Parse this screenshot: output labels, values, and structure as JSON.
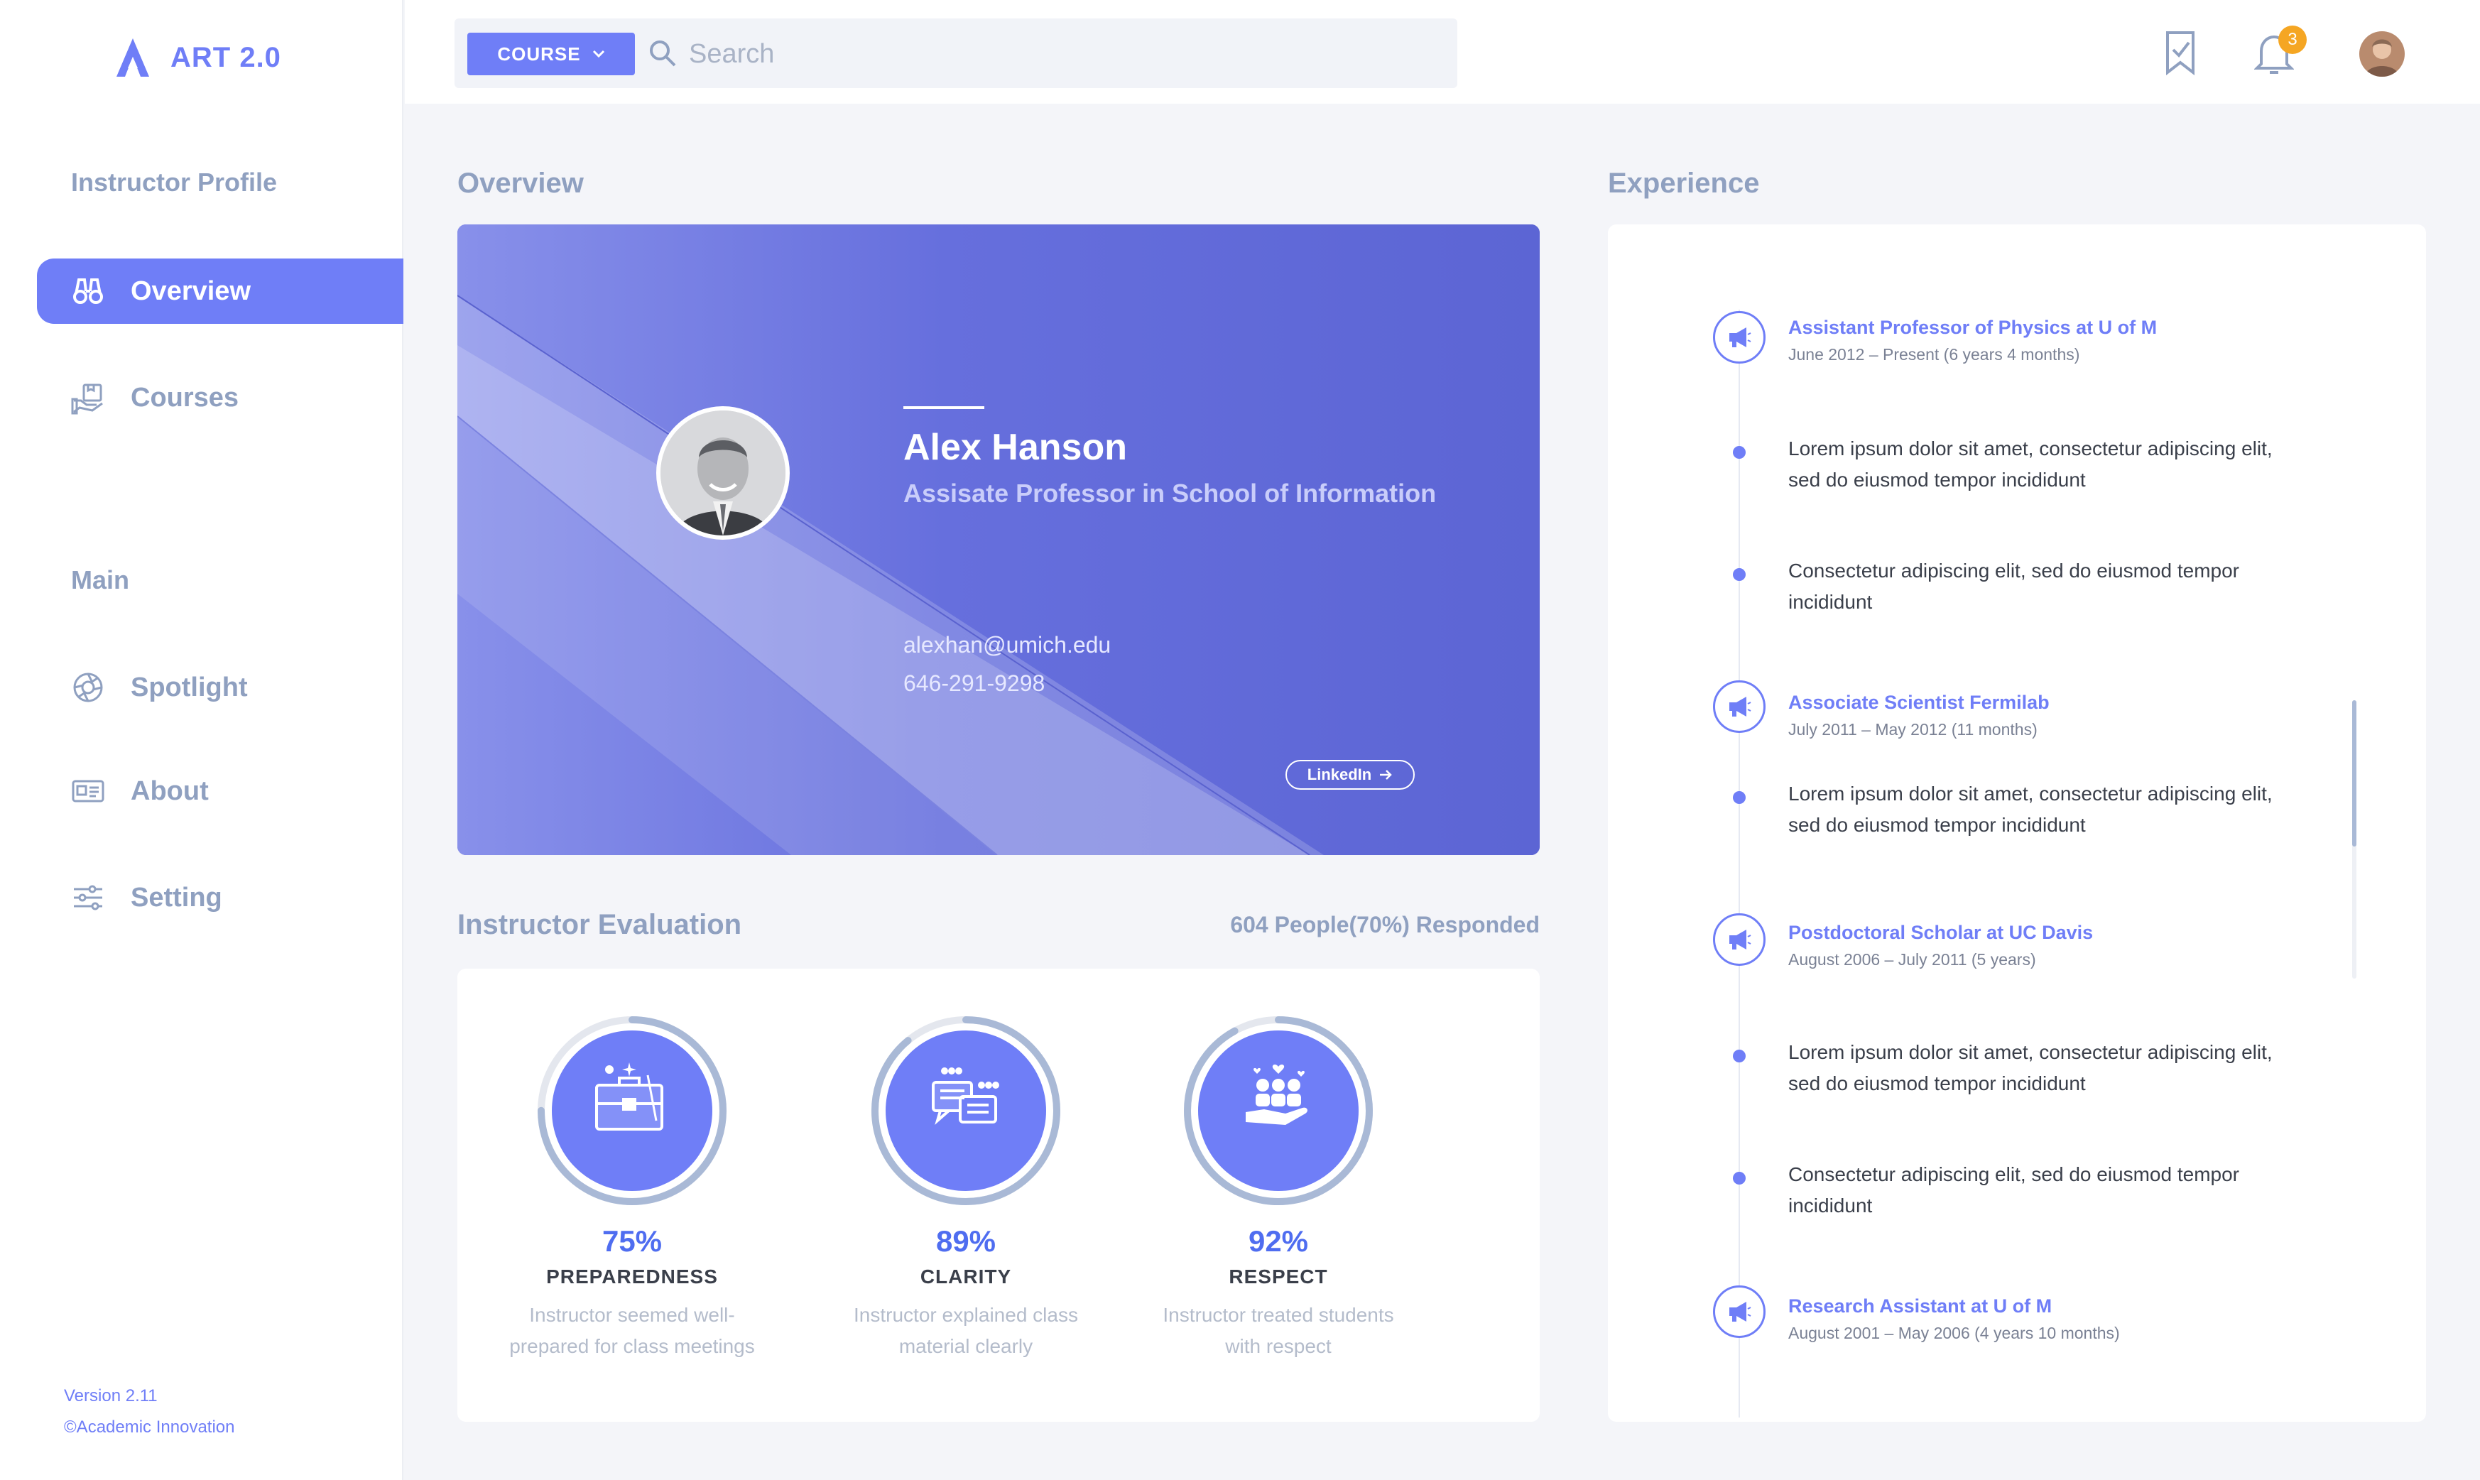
{
  "app": {
    "name": "ART 2.0",
    "version": "Version 2.11",
    "copyright": "©Academic Innovation"
  },
  "sidebar": {
    "heading_profile": "Instructor Profile",
    "heading_main": "Main",
    "items": [
      {
        "label": "Overview",
        "icon": "binoculars-icon",
        "active": true
      },
      {
        "label": "Courses",
        "icon": "courses-icon",
        "active": false
      },
      {
        "label": "Spotlight",
        "icon": "aperture-icon",
        "active": false
      },
      {
        "label": "About",
        "icon": "id-card-icon",
        "active": false
      },
      {
        "label": "Setting",
        "icon": "sliders-icon",
        "active": false
      }
    ]
  },
  "topbar": {
    "course_button": "COURSE",
    "search_placeholder": "Search",
    "notification_count": "3"
  },
  "overview": {
    "section_title": "Overview",
    "name": "Alex Hanson",
    "title": "Assisate Professor in School of Information",
    "email": "alexhan@umich.edu",
    "phone": "646-291-9298",
    "linkedin_label": "LinkedIn"
  },
  "evaluation": {
    "section_title": "Instructor Evaluation",
    "responded": "604 People(70%) Responded",
    "items": [
      {
        "percent": "75%",
        "value": 0.75,
        "name": "PREPAREDNESS",
        "desc_line1": "Instructor seemed well-",
        "desc_line2": "prepared for class meetings",
        "icon": "briefcase-icon"
      },
      {
        "percent": "89%",
        "value": 0.89,
        "name": "CLARITY",
        "desc_line1": "Instructor explained class",
        "desc_line2": "material clearly",
        "icon": "chat-bubbles-icon"
      },
      {
        "percent": "92%",
        "value": 0.92,
        "name": "RESPECT",
        "desc_line1": "Instructor treated students",
        "desc_line2": "with respect",
        "icon": "people-hand-icon"
      }
    ]
  },
  "experience": {
    "section_title": "Experience",
    "jobs": [
      {
        "title": "Assistant Professor of Physics at U of M",
        "dates": "June 2012 – Present (6 years 4 months)"
      },
      {
        "title": "Associate Scientist Fermilab",
        "dates": "July 2011 – May 2012 (11 months)"
      },
      {
        "title": "Postdoctoral Scholar at UC Davis",
        "dates": "August 2006 – July 2011 (5 years)"
      },
      {
        "title": "Research Assistant at U of M",
        "dates": "August 2001 – May 2006 (4 years 10 months)"
      }
    ],
    "bullets": [
      {
        "line1": "Lorem ipsum dolor sit amet, consectetur adipiscing elit,",
        "line2": "sed do eiusmod tempor incididunt"
      },
      {
        "line1": "Consectetur adipiscing elit, sed do eiusmod tempor",
        "line2": "incididunt"
      },
      {
        "line1": "Lorem ipsum dolor sit amet, consectetur adipiscing elit,",
        "line2": "sed do eiusmod tempor incididunt"
      },
      {
        "line1": "Lorem ipsum dolor sit amet, consectetur adipiscing elit,",
        "line2": "sed do eiusmod tempor incididunt"
      },
      {
        "line1": "Consectetur adipiscing elit, sed do eiusmod tempor",
        "line2": "incididunt"
      }
    ]
  },
  "colors": {
    "accent": "#6f7ef7",
    "card": "#6169d8",
    "muted": "#8fa0c0",
    "badge": "#f5a623",
    "ring": "#a9b9d6"
  }
}
